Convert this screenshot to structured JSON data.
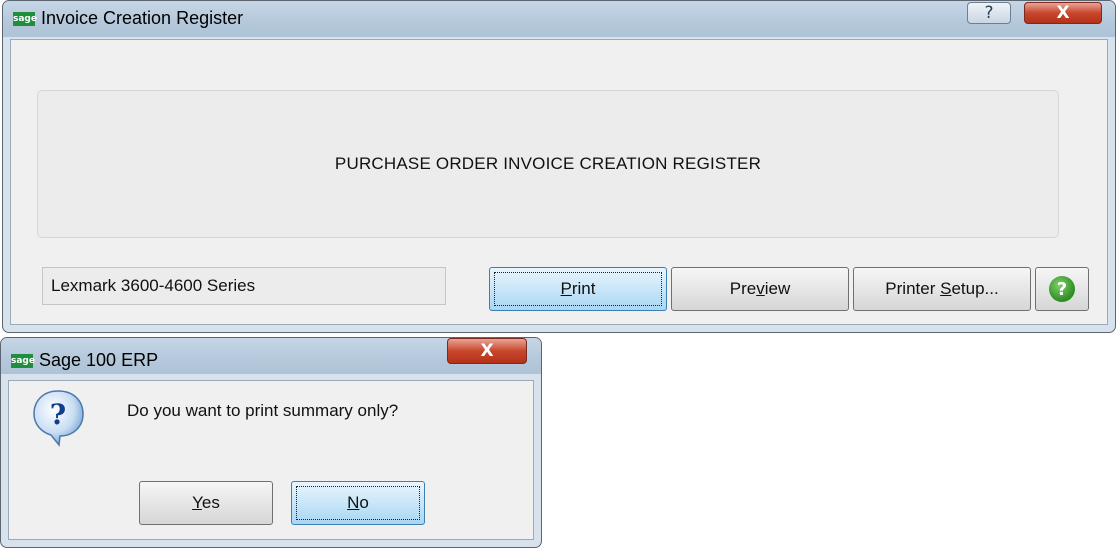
{
  "main_window": {
    "logo_text": "sage",
    "title": "Invoice Creation Register",
    "help_glyph": "?",
    "close_glyph": "X",
    "banner_text": "PURCHASE ORDER INVOICE CREATION REGISTER",
    "printer_name": "Lexmark 3600-4600 Series",
    "buttons": {
      "print": {
        "pre": "",
        "key": "P",
        "post": "rint"
      },
      "preview": {
        "pre": "Pre",
        "key": "v",
        "post": "iew"
      },
      "printer_setup": {
        "pre": "Printer ",
        "key": "S",
        "post": "etup..."
      }
    },
    "help_round_glyph": "?"
  },
  "dialog": {
    "logo_text": "sage",
    "title": "Sage 100 ERP",
    "close_glyph": "X",
    "question_glyph": "?",
    "message": "Do you want to print summary only?",
    "buttons": {
      "yes": {
        "key": "Y",
        "post": "es"
      },
      "no": {
        "key": "N",
        "post": "o"
      }
    }
  },
  "colors": {
    "accent_green": "#1f8f3d",
    "close_red": "#c8462c",
    "default_button_blue": "#a9d6f3"
  }
}
